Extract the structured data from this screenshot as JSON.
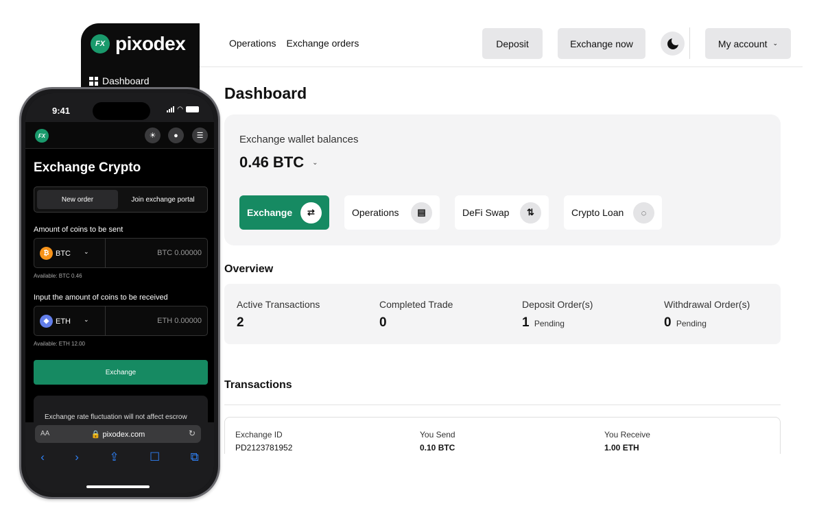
{
  "brand": {
    "name": "pixodex",
    "mark": "FX"
  },
  "sidebar": {
    "items": [
      {
        "label": "Dashboard"
      }
    ]
  },
  "topnav": {
    "links": [
      "Operations",
      "Exchange orders"
    ],
    "deposit": "Deposit",
    "exchange_now": "Exchange now",
    "account": "My account"
  },
  "dashboard": {
    "title": "Dashboard",
    "wallet_label": "Exchange wallet balances",
    "balance": "0.46 BTC",
    "actions": [
      {
        "label": "Exchange",
        "icon": "swap-icon",
        "glyph": "⇄"
      },
      {
        "label": "Operations",
        "icon": "receipt-icon",
        "glyph": "▤"
      },
      {
        "label": "DeFi Swap",
        "icon": "up-down-arrows-icon",
        "glyph": "⇅"
      },
      {
        "label": "Crypto Loan",
        "icon": "loop-icon",
        "glyph": "◌"
      }
    ]
  },
  "overview": {
    "title": "Overview",
    "items": [
      {
        "label": "Active Transactions",
        "value": "2",
        "suffix": ""
      },
      {
        "label": "Completed Trade",
        "value": "0",
        "suffix": ""
      },
      {
        "label": "Deposit Order(s)",
        "value": "1",
        "suffix": "Pending"
      },
      {
        "label": "Withdrawal Order(s)",
        "value": "0",
        "suffix": "Pending"
      }
    ]
  },
  "transactions": {
    "title": "Transactions",
    "columns": [
      "Exchange ID",
      "You Send",
      "You Receive"
    ],
    "rows": [
      [
        "PD2123781952",
        "0.10 BTC",
        "1.00 ETH"
      ]
    ]
  },
  "phone": {
    "time": "9:41",
    "title": "Exchange Crypto",
    "tabs": [
      "New order",
      "Join exchange portal"
    ],
    "send_label": "Amount of coins to be sent",
    "send_coin": "BTC",
    "send_placeholder": "BTC 0.00000",
    "send_available": "Available: BTC 0.46",
    "receive_label": "Input the amount of coins to be received",
    "receive_coin": "ETH",
    "receive_placeholder": "ETH 0.00000",
    "receive_available": "Available: ETH 12.00",
    "exchange_button": "Exchange",
    "note": "Exchange rate fluctuation will not affect escrow amounts during exchange. Once",
    "url": "pixodex.com",
    "aa": "AA"
  },
  "colors": {
    "accent": "#168a62",
    "sidebar": "#0c0c0c",
    "btc": "#f7931a",
    "eth": "#627eea"
  }
}
